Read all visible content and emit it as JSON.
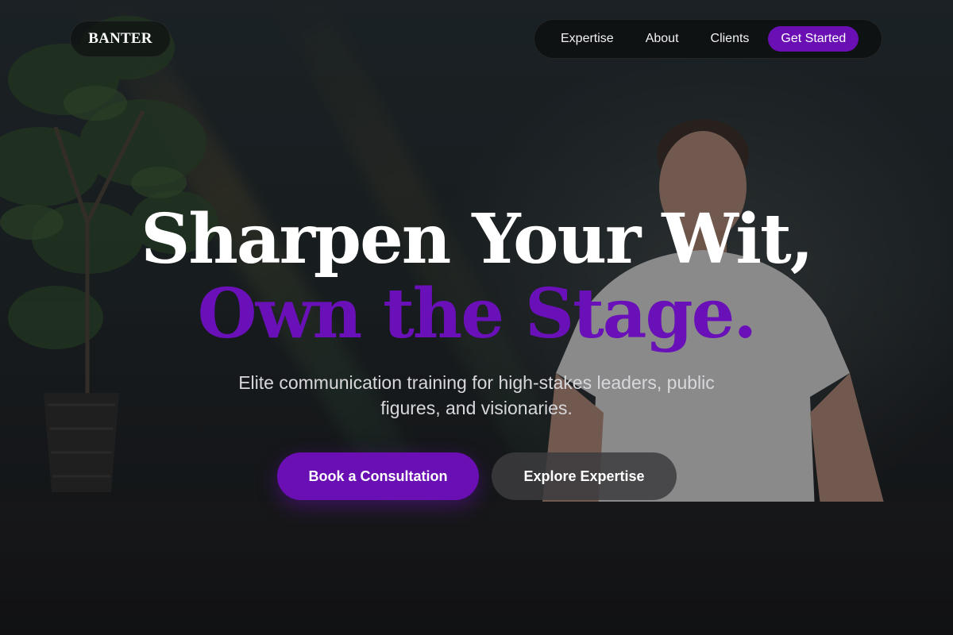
{
  "brand": {
    "logo_text": "BANTER"
  },
  "nav": {
    "items": [
      {
        "label": "Expertise"
      },
      {
        "label": "About"
      },
      {
        "label": "Clients"
      }
    ],
    "cta_label": "Get Started"
  },
  "hero": {
    "headline_line1": "Sharpen Your Wit,",
    "headline_line2": "Own the Stage.",
    "subtext": "Elite communication training for high-stakes leaders, public figures, and visionaries.",
    "primary_button": "Book a Consultation",
    "secondary_button": "Explore Expertise"
  },
  "colors": {
    "accent": "#6a0fb3",
    "background": "#1a1c1d",
    "text": "#ffffff",
    "muted_text": "#d8d8dc",
    "secondary_button": "#3c3c3e"
  },
  "icons": [
    "plant-illustration",
    "person-illustration"
  ]
}
